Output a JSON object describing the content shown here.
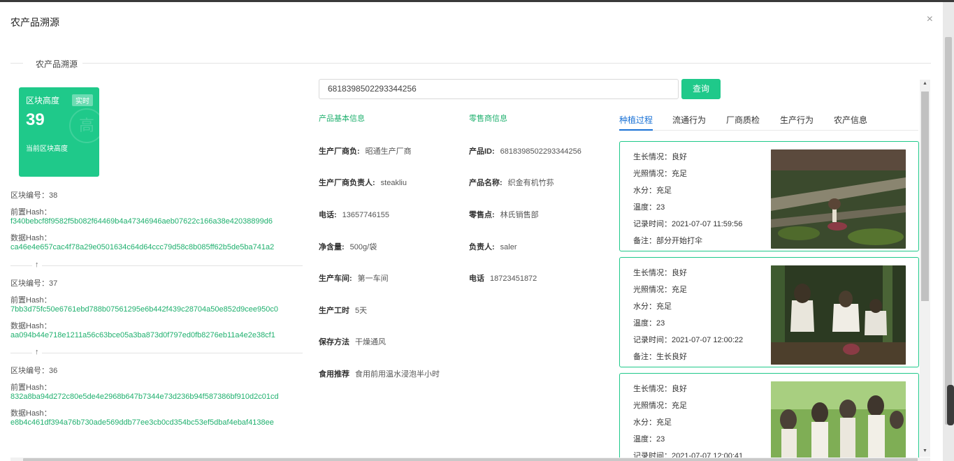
{
  "modal": {
    "title": "农产品溯源",
    "close": "×"
  },
  "section": {
    "label": "农产品溯源"
  },
  "block_card": {
    "label": "区块高度",
    "tag": "实时",
    "height": "39",
    "sub": "当前区块高度",
    "watermark": "高"
  },
  "chain": [
    {
      "no": "区块编号：38",
      "prev_label": "前置Hash：",
      "prev": "f340bebcf8f9582f5b082f64469b4a47346946aeb07622c166a38e42038899d6",
      "data_label": "数据Hash：",
      "data": "ca46e4e657cac4f78a29e0501634c64d64ccc79d58c8b085ff62b5de5ba741a2"
    },
    {
      "no": "区块编号：37",
      "prev_label": "前置Hash：",
      "prev": "7bb3d75fc50e6761ebd788b07561295e6b442f439c28704a50e852d9cee950c0",
      "data_label": "数据Hash：",
      "data": "aa094b44e718e1211a56c63bce05a3ba873d0f797ed0fb8276eb11a4e2e38cf1"
    },
    {
      "no": "区块编号：36",
      "prev_label": "前置Hash：",
      "prev": "832a8ba94d272c80e5de4e2968b647b7344e73d236b94f587386bf910d2c01cd",
      "data_label": "数据Hash：",
      "data": "e8b4c461df394a76b730ade569ddb77ee3cb0cd354bc53ef5dbaf4ebaf4138ee"
    }
  ],
  "arrow": "↑",
  "search": {
    "value": "6818398502293344256",
    "button": "查询"
  },
  "product": {
    "title": "产品基本信息",
    "fields": [
      {
        "k": "生产厂商负:",
        "v": "昭通生产厂商"
      },
      {
        "k": "生产厂商负责人:",
        "v": "steakliu"
      },
      {
        "k": "电话:",
        "v": "13657746155"
      },
      {
        "k": "净含量:",
        "v": "500g/袋"
      },
      {
        "k": "生产车间:",
        "v": "第一车间"
      },
      {
        "k": "生产工时",
        "v": "5天"
      },
      {
        "k": "保存方法",
        "v": "干燥通风"
      },
      {
        "k": "食用推荐",
        "v": "食用前用温水浸泡半小时"
      }
    ]
  },
  "retailer": {
    "title": "零售商信息",
    "fields": [
      {
        "k": "产品ID:",
        "v": "6818398502293344256"
      },
      {
        "k": "产品名称:",
        "v": "织金有机竹荪"
      },
      {
        "k": "零售点:",
        "v": "林氏销售部"
      },
      {
        "k": "负责人:",
        "v": "saler"
      },
      {
        "k": "电话",
        "v": "18723451872"
      }
    ]
  },
  "tabs": [
    "种植过程",
    "流通行为",
    "厂商质检",
    "生产行为",
    "农产信息"
  ],
  "records": [
    {
      "l1": "生长情况：良好",
      "l2": "光照情况：充足",
      "l3": "水分：充足",
      "l4": "温度：23",
      "l5": "记录时间：2021-07-07 11:59:56",
      "l6": "备注：部分开始打伞"
    },
    {
      "l1": "生长情况：良好",
      "l2": "光照情况：充足",
      "l3": "水分：充足",
      "l4": "温度：23",
      "l5": "记录时间：2021-07-07 12:00:22",
      "l6": "备注：生长良好"
    },
    {
      "l1": "生长情况：良好",
      "l2": "光照情况：充足",
      "l3": "水分：充足",
      "l4": "温度：23",
      "l5": "记录时间：2021-07-07 12:00:41",
      "l6": ""
    }
  ],
  "colors": {
    "accent": "#1fc98a",
    "hash": "#1fb06e",
    "tab_active": "#1a72d6"
  }
}
